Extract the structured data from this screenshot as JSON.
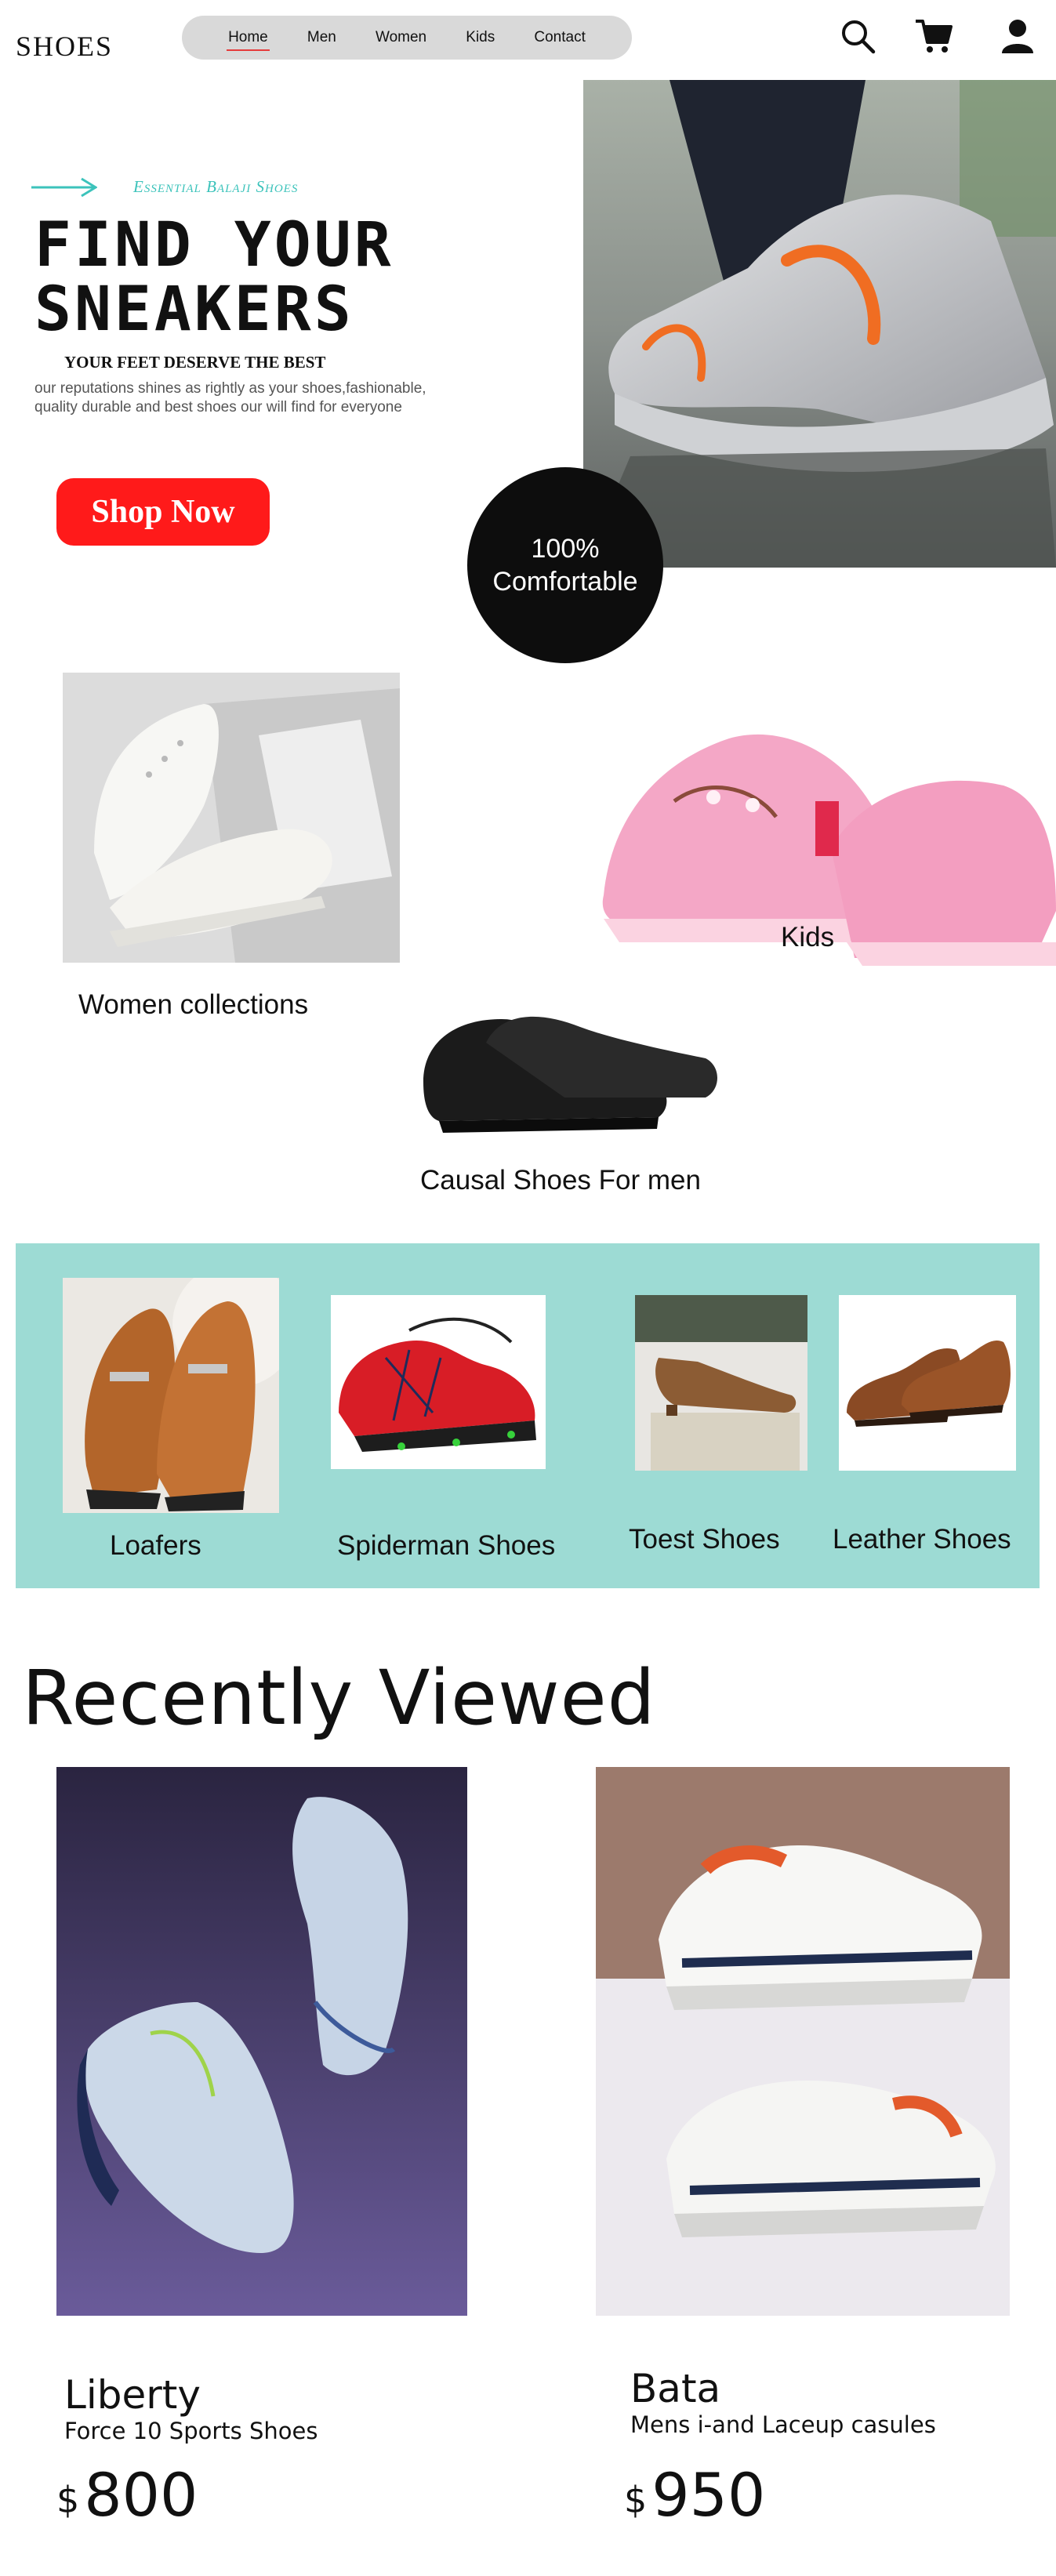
{
  "header": {
    "brand": "SHOES",
    "nav": [
      "Home",
      "Men",
      "Women",
      "Kids",
      "Contact"
    ],
    "icons": [
      "search-icon",
      "cart-icon",
      "user-icon"
    ]
  },
  "hero": {
    "tagline": "Essential Balaji Shoes",
    "title_line1": "FIND YOUR",
    "title_line2": "SNEAKERS",
    "subtitle": "YOUR FEET DESERVE THE BEST",
    "description": "our reputations shines as rightly as your shoes,fashionable, quality durable and best shoes our will find for everyone",
    "cta": "Shop Now",
    "badge_line1": "100%",
    "badge_line2": "Comfortable"
  },
  "categories": {
    "women": "Women collections",
    "kids": "Kids",
    "men": "Causal Shoes For men"
  },
  "strip": {
    "items": [
      "Loafers",
      "Spiderman Shoes",
      "Toest Shoes",
      "Leather Shoes"
    ]
  },
  "recent": {
    "title": "Recently Viewed",
    "products": [
      {
        "brand": "Liberty",
        "name": "Force 10 Sports Shoes",
        "currency": "$",
        "price": "800"
      },
      {
        "brand": "Bata",
        "name": "Mens i-and Laceup casules",
        "currency": "$",
        "price": "950"
      }
    ]
  },
  "colors": {
    "accent": "#ff1a1a",
    "teal": "#9ddbd4",
    "tagline": "#3cc3bb",
    "nav_bg": "#d9d9d9"
  }
}
